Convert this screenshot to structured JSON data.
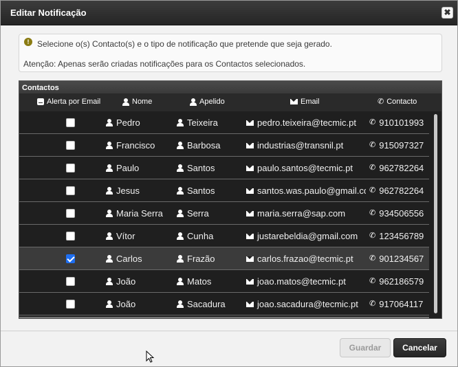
{
  "dialog": {
    "title": "Editar Notificação",
    "close_glyph": "✖"
  },
  "info": {
    "icon": "!",
    "line1": "Selecione o(s) Contacto(s) e o tipo de notificação que pretende que seja gerado.",
    "line2": "Atenção: Apenas serão criadas notificações para os Contactos selecionados."
  },
  "grid": {
    "caption": "Contactos",
    "columns": {
      "alert": "Alerta por Email",
      "nome": "Nome",
      "apelido": "Apelido",
      "email": "Email",
      "contacto": "Contacto"
    },
    "rows": [
      {
        "checked": false,
        "nome": "Pedro",
        "apelido": "Teixeira",
        "email": "pedro.teixeira@tecmic.pt",
        "contacto": "910101993"
      },
      {
        "checked": false,
        "nome": "Francisco",
        "apelido": "Barbosa",
        "email": "industrias@transnil.pt",
        "contacto": "915097327"
      },
      {
        "checked": false,
        "nome": "Paulo",
        "apelido": "Santos",
        "email": "paulo.santos@tecmic.pt",
        "contacto": "962782264"
      },
      {
        "checked": false,
        "nome": "Jesus",
        "apelido": "Santos",
        "email": "santos.was.paulo@gmail.co",
        "contacto": "962782264"
      },
      {
        "checked": false,
        "nome": "Maria Serra",
        "apelido": "Serra",
        "email": "maria.serra@sap.com",
        "contacto": "934506556"
      },
      {
        "checked": false,
        "nome": "Vítor",
        "apelido": "Cunha",
        "email": "justarebeldia@gmail.com",
        "contacto": "123456789"
      },
      {
        "checked": true,
        "nome": "Carlos",
        "apelido": "Frazão",
        "email": "carlos.frazao@tecmic.pt",
        "contacto": "901234567"
      },
      {
        "checked": false,
        "nome": "João",
        "apelido": "Matos",
        "email": "joao.matos@tecmic.pt",
        "contacto": "962186579"
      },
      {
        "checked": false,
        "nome": "João",
        "apelido": "Sacadura",
        "email": "joao.sacadura@tecmic.pt",
        "contacto": "917064117"
      }
    ]
  },
  "buttons": {
    "save": "Guardar",
    "cancel": "Cancelar"
  },
  "colors": {
    "accent_checkbox": "#1e6ff2",
    "grid_background": "#1f1f1f",
    "title_bar": "#2f2f2f"
  }
}
